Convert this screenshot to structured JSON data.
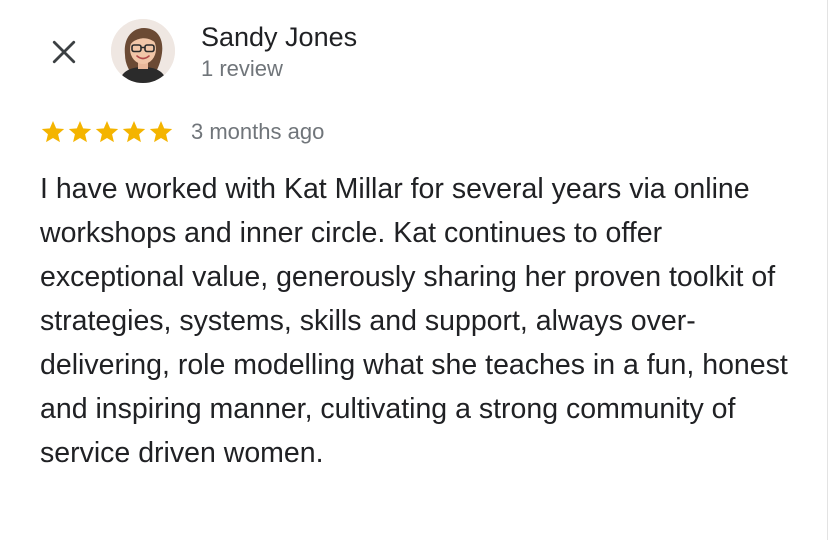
{
  "reviewer": {
    "name": "Sandy Jones",
    "review_count": "1 review"
  },
  "review": {
    "rating": 5,
    "rating_max": 5,
    "date": "3 months ago",
    "text": "I have worked with Kat Millar for several years via online workshops and inner circle. Kat continues to offer exceptional value, generously sharing her proven toolkit of strategies, systems, skills and support, always over-delivering, role modelling what she teaches in a fun, honest and inspiring manner, cultivating a strong community of service driven women."
  },
  "icons": {
    "close": "close-icon",
    "star": "star-icon",
    "avatar": "avatar"
  },
  "colors": {
    "star": "#f4b400",
    "name": "#202124",
    "secondary_text": "#70757a",
    "body_text": "#202124",
    "background": "#ffffff"
  }
}
